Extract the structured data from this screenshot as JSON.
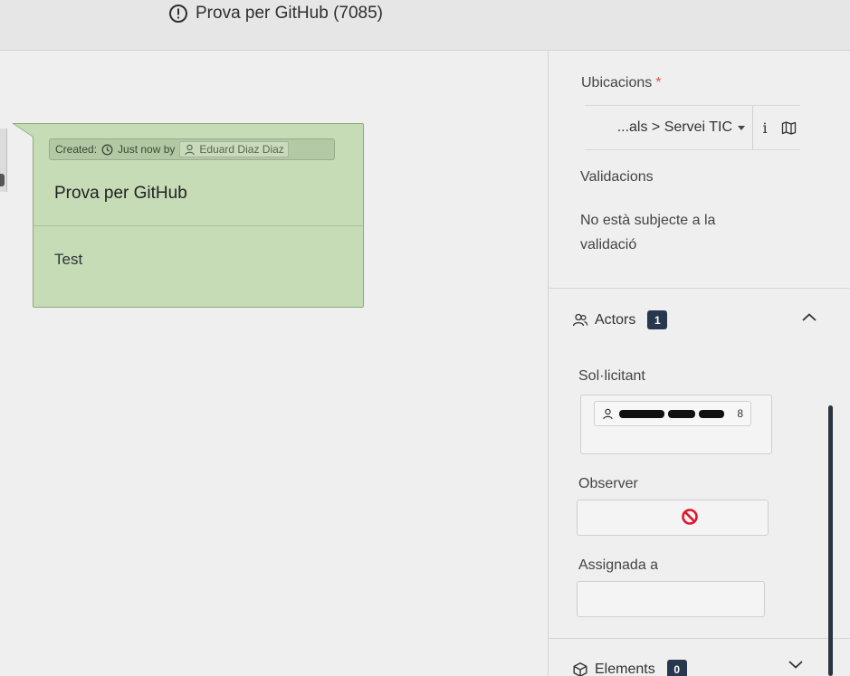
{
  "header": {
    "title": "Prova per GitHub (7085)",
    "title_icon": "exclamation-circle-icon"
  },
  "followup": {
    "created_label": "Created:",
    "created_time": "Just now by",
    "author": "Eduard Diaz Diaz",
    "title": "Prova per GitHub",
    "body": "Test",
    "background_color": "#c5dcb7"
  },
  "side": {
    "locations_label": "Ubicacions",
    "required_mark": "*",
    "location_value": "...als > Servei TIC",
    "location_info_label": "i",
    "validations_label": "Validacions",
    "validation_text": "No està subjecte a la validació",
    "actors": {
      "label": "Actors",
      "count": "1",
      "requester_label": "Sol·licitant",
      "requester_count": "8",
      "observer_label": "Observer",
      "assigned_label": "Assignada a"
    },
    "elements": {
      "label": "Elements",
      "count": "0"
    },
    "badge_color": "#27374d"
  }
}
